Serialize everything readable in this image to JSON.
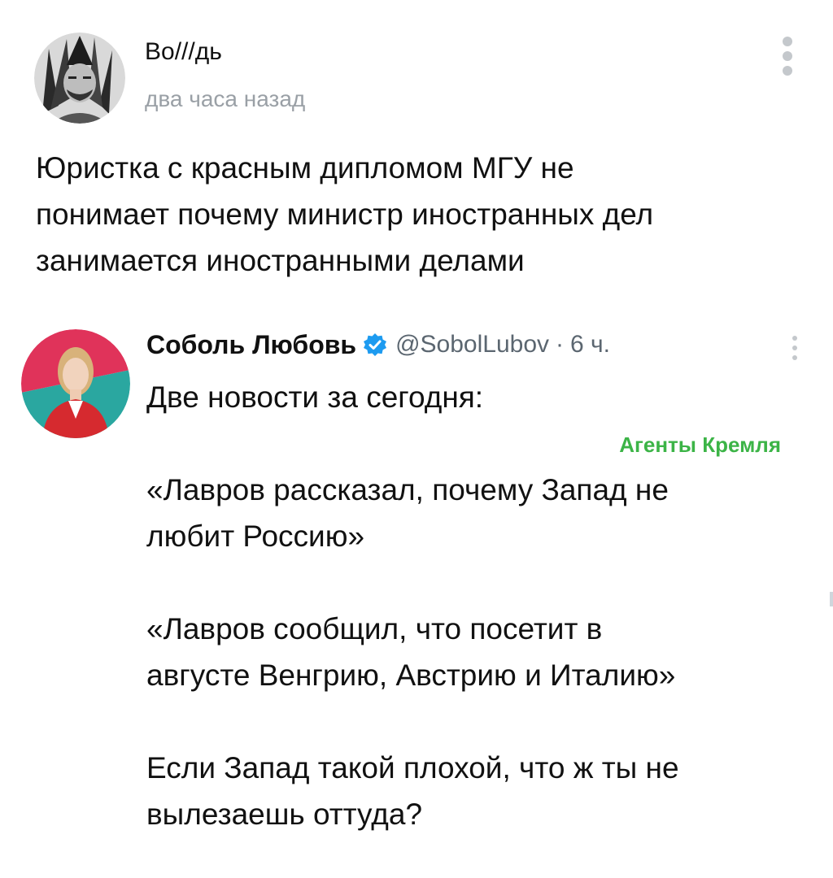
{
  "post": {
    "author": "Во///дь",
    "time": "два часа назад",
    "menu_icon": "vertical-dots-icon",
    "text_lines": [
      "Юристка с красным дипломом МГУ не",
      "понимает почему министр иностранных дел",
      "занимается иностранными делами"
    ]
  },
  "tweet": {
    "name": "Соболь Любовь",
    "verified_icon": "verified-badge-icon",
    "handle": "@SobolLubov",
    "dot": "·",
    "time": "6 ч.",
    "menu_icon": "vertical-dots-icon",
    "lines": [
      "Две новости за сегодня:",
      "«Лавров рассказал, почему Запад не",
      "любит Россию»",
      "«Лавров сообщил, что посетит в",
      "августе Венгрию, Австрию и Италию»",
      "Если Запад такой плохой, что ж ты не",
      "вылезаешь оттуда?"
    ]
  },
  "watermark": "Агенты Кремля",
  "colors": {
    "verified_blue": "#1d9bf0",
    "watermark_green": "#3cb447",
    "muted_text": "#9aa0a6",
    "handle_gray": "#5b6670"
  }
}
